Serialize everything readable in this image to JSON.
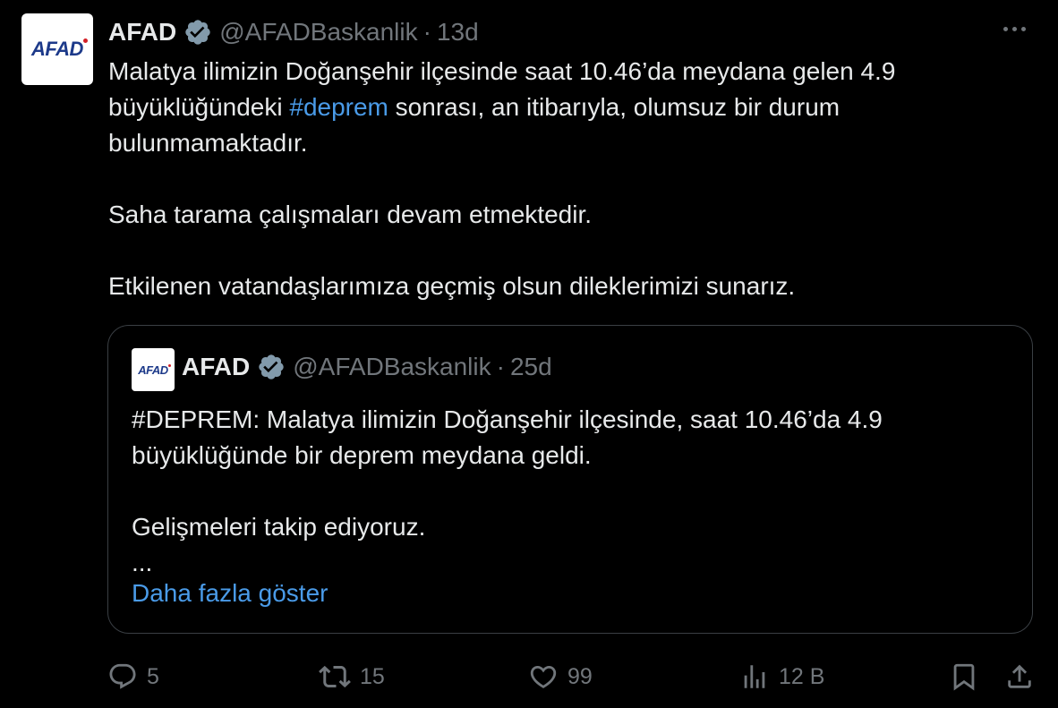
{
  "tweet": {
    "display_name": "AFAD",
    "handle": "@AFADBaskanlik",
    "separator": "·",
    "time": "13d",
    "avatar_text": "AFAD",
    "text_part1": "Malatya ilimizin Doğanşehir ilçesinde saat 10.46’da meydana gelen 4.9 büyüklüğündeki ",
    "hashtag": "#deprem",
    "text_part2": " sonrası, an itibarıyla, olumsuz bir durum bulunmamaktadır.",
    "paragraph2": "Saha tarama çalışmaları devam etmektedir.",
    "paragraph3": "Etkilenen vatandaşlarımıza geçmiş olsun dileklerimizi sunarız."
  },
  "quote": {
    "display_name": "AFAD",
    "handle": "@AFADBaskanlik",
    "separator": "·",
    "time": "25d",
    "avatar_text": "AFAD",
    "paragraph1": "#DEPREM: Malatya ilimizin Doğanşehir ilçesinde, saat 10.46’da 4.9 büyüklüğünde bir deprem meydana geldi.",
    "paragraph2": "Gelişmeleri takip ediyoruz.",
    "ellipsis": "...",
    "show_more": "Daha fazla göster"
  },
  "actions": {
    "replies": "5",
    "retweets": "15",
    "likes": "99",
    "views": "12 B"
  },
  "colors": {
    "background": "#000000",
    "text": "#e7e9ea",
    "muted": "#71767b",
    "link": "#4a9be8",
    "verified": "#829aab",
    "border": "#3a3f44"
  },
  "icons": [
    "verified-badge-icon",
    "more-icon",
    "reply-icon",
    "retweet-icon",
    "like-icon",
    "views-icon",
    "bookmark-icon",
    "share-icon"
  ]
}
